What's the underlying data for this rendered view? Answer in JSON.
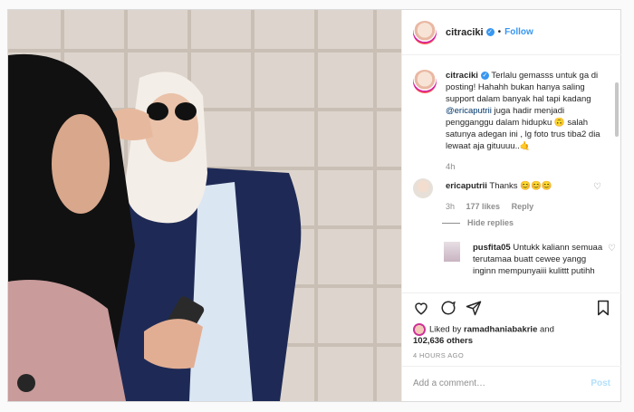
{
  "header": {
    "username": "citraciki",
    "follow_label": "Follow",
    "dot": "•"
  },
  "caption": {
    "username": "citraciki",
    "text_before": "Terlalu gemasss untuk ga di posting! Hahahh bukan hanya saling support dalam banyak hal tapi kadang",
    "mention": "@ericaputrii",
    "text_after": "juga hadir menjadi pengganggu dalam hidupku 🙃 salah satunya adegan ini , lg foto trus tiba2 dia lewaat aja gituuuu..🤙",
    "time": "4h"
  },
  "comment1": {
    "username": "ericaputrii",
    "text": "Thanks 😊😊😊",
    "time": "3h",
    "likes": "177 likes",
    "reply": "Reply",
    "hide_replies": "Hide replies"
  },
  "comment2": {
    "username": "pusfita05",
    "text": "Untukk kaliann semuaa terutamaa buatt cewee yangg inginn mempunyaiii kulittt putihh"
  },
  "likes": {
    "liked_by": "Liked by",
    "name": "ramadhaniabakrie",
    "and": "and",
    "others": "102,636 others"
  },
  "time_ago": "4 HOURS AGO",
  "add_comment": {
    "placeholder": "Add a comment…",
    "post_label": "Post"
  }
}
